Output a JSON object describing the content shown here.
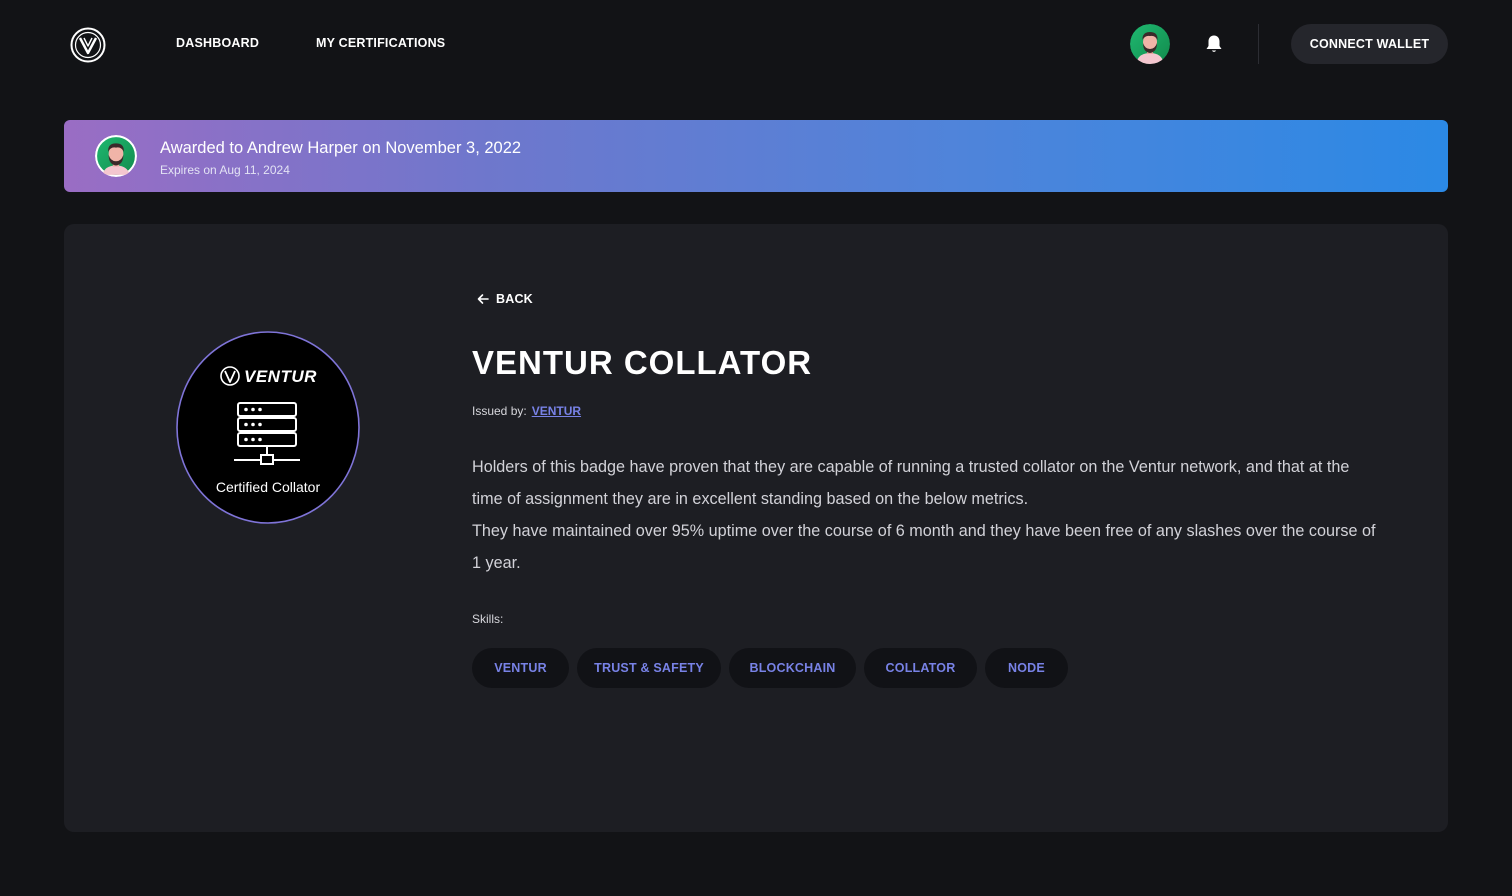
{
  "nav": {
    "logo_icon": "ventur-v-logo",
    "links": [
      "DASHBOARD",
      "MY CERTIFICATIONS"
    ],
    "avatar_icon": "user-avatar",
    "bell_icon": "bell-icon",
    "connect_label": "CONNECT WALLET"
  },
  "banner": {
    "title": "Awarded to Andrew Harper on November 3, 2022",
    "subtitle": "Expires on Aug 11, 2024",
    "gradient_start": "#9a6dc4",
    "gradient_end": "#2b89e5"
  },
  "badge": {
    "brand": "VENTUR",
    "caption": "Certified Collator",
    "icon": "server-network-icon",
    "ring_color": "#7f74d8"
  },
  "cert": {
    "back_label": "BACK",
    "title": "VENTUR COLLATOR",
    "issued_label": "Issued by:",
    "issuer": "VENTUR",
    "description_1": "Holders of this badge have proven that they are capable of running a trusted collator on the Ventur network, and that at the time of assignment they are in excellent standing based on the below metrics.",
    "description_2": "They have maintained over 95% uptime over the course of 6 month and they have been free of any slashes over the course of 1 year.",
    "skills_label": "Skills:",
    "skills": [
      "VENTUR",
      "TRUST & SAFETY",
      "BLOCKCHAIN",
      "COLLATOR",
      "NODE"
    ]
  },
  "colors": {
    "background": "#121316",
    "card": "#1d1e23",
    "accent": "#7882e6",
    "chip": "#111216"
  }
}
